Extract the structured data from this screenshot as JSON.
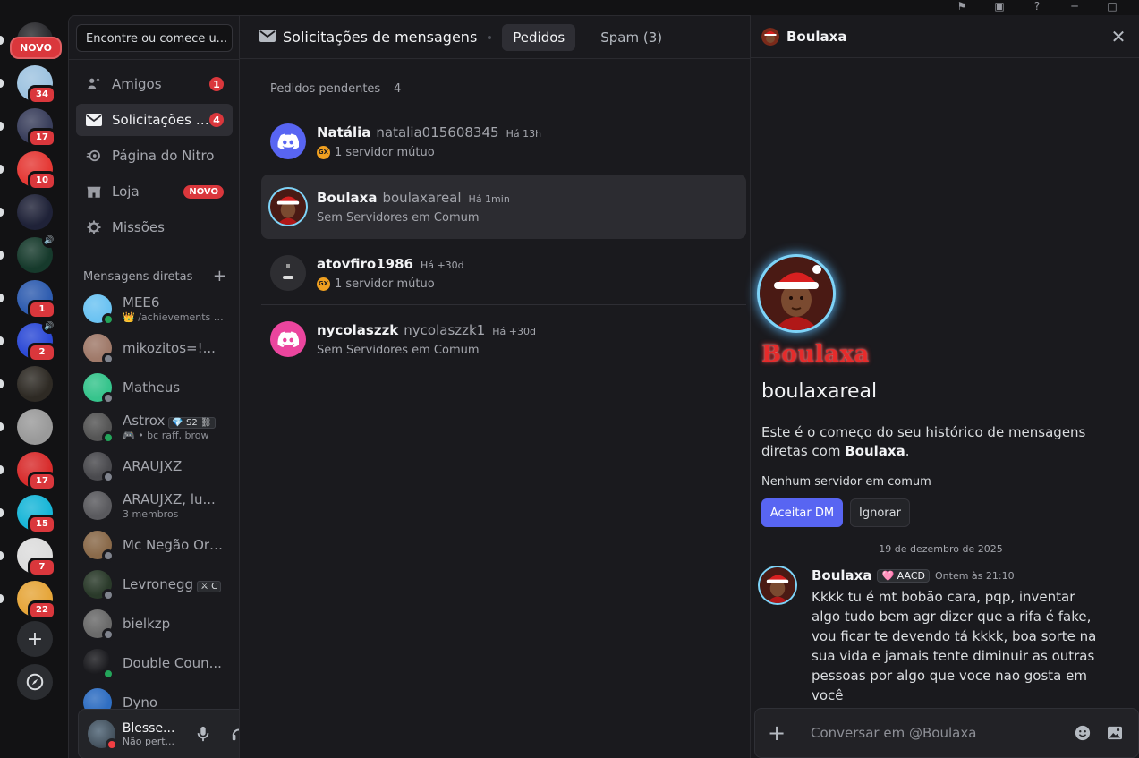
{
  "titlebar": {
    "icons": [
      "flag-icon",
      "inbox-icon",
      "help-icon",
      "minimize-icon",
      "maximize-icon"
    ]
  },
  "servers": {
    "new_badge": "NOVO",
    "items": [
      {
        "name": "server-1",
        "badge": "",
        "color": "#2a2a2e"
      },
      {
        "name": "server-gamers",
        "badge": "34",
        "color": "#9ec3e0"
      },
      {
        "name": "server-3",
        "badge": "17",
        "color": "#3a3f5c"
      },
      {
        "name": "server-4",
        "badge": "10",
        "color": "#e53935"
      },
      {
        "name": "server-5",
        "badge": "",
        "color": "#1f2238"
      },
      {
        "name": "server-6",
        "badge": "",
        "color": "#163a2c"
      },
      {
        "name": "server-7",
        "badge": "1",
        "color": "#2f5db0"
      },
      {
        "name": "server-8",
        "badge": "2",
        "color": "#2c4ad6"
      },
      {
        "name": "server-thats-cheapass",
        "badge": "",
        "color": "#2e2a24"
      },
      {
        "name": "server-10",
        "badge": "",
        "color": "#9a9a9a"
      },
      {
        "name": "server-11",
        "badge": "17",
        "color": "#d82c2c"
      },
      {
        "name": "server-12",
        "badge": "15",
        "color": "#18b6d8"
      },
      {
        "name": "server-13",
        "badge": "7",
        "color": "#dcdcdc"
      },
      {
        "name": "server-14",
        "badge": "22",
        "color": "#e6a63a"
      }
    ]
  },
  "sidebar": {
    "search_placeholder": "Encontre ou comece u...",
    "nav": [
      {
        "label": "Amigos",
        "count": "1"
      },
      {
        "label": "Solicitações de mensagens",
        "count": "4"
      },
      {
        "label": "Página do Nitro"
      },
      {
        "label": "Loja",
        "new": "NOVO"
      },
      {
        "label": "Missões"
      }
    ],
    "dm_header": "Mensagens diretas",
    "dms": [
      {
        "name": "MEE6",
        "sub": "👑 /achievements 👑",
        "status": "on",
        "color": "#6cc3f2"
      },
      {
        "name": "mikozitos=!...",
        "sub": "",
        "status": "off",
        "color": "#a07a6a"
      },
      {
        "name": "Matheus",
        "sub": "",
        "status": "off",
        "color": "#36c48c"
      },
      {
        "name": "Astrox",
        "tag": "💎 S2 ⛓",
        "sub": "🎮 • bc raff, brow",
        "status": "on",
        "color": "#555"
      },
      {
        "name": "ARAUJXZ",
        "sub": "",
        "status": "off",
        "color": "#4a4a4e"
      },
      {
        "name": "ARAUJXZ, lu...",
        "sub": "3 membros",
        "status": "",
        "color": "#5a5a5e"
      },
      {
        "name": "Mc Negão Ori...",
        "sub": "",
        "status": "off",
        "color": "#8a6a4a"
      },
      {
        "name": "Levronegg",
        "tag": "⚔ C",
        "sub": "",
        "status": "off",
        "color": "#2a3a2a"
      },
      {
        "name": "bielkzp",
        "sub": "",
        "status": "off",
        "color": "#6a6a6a"
      },
      {
        "name": "Double Coun...",
        "sub": "",
        "status": "on",
        "color": "#1a1a1e"
      },
      {
        "name": "Dyno",
        "sub": "",
        "status": "",
        "color": "#2f6ec2"
      }
    ],
    "user": {
      "name": "Blesse...",
      "status": "Não pert..."
    }
  },
  "main": {
    "title": "Solicitações de mensagens",
    "tabs": [
      {
        "label": "Pedidos"
      },
      {
        "label": "Spam (3)"
      }
    ],
    "pending_label": "Pedidos pendentes – 4",
    "requests": [
      {
        "name": "Natália",
        "username": "natalia015608345",
        "time": "Há 13h",
        "mutual": "1 servidor mútuo",
        "avatar_color": "#5865f2"
      },
      {
        "name": "Boulaxa",
        "username": "boulaxareal",
        "time": "Há 1min",
        "mutual": "Sem Servidores em Comum",
        "avatar_color": "#6b3a2a"
      },
      {
        "name": "atovfiro1986",
        "username": "",
        "time": "Há +30d",
        "mutual": "1 servidor mútuo",
        "avatar_color": "#2e2e32"
      },
      {
        "name": "nycolaszzk",
        "username": "nycolaszzk1",
        "time": "Há +30d",
        "mutual": "Sem Servidores em Comum",
        "avatar_color": "#eb459e"
      }
    ]
  },
  "panel": {
    "header_name": "Boulaxa",
    "display_name": "Boulaxa",
    "username": "boulaxareal",
    "history_prefix": "Este é o começo do seu histórico de mensagens diretas com ",
    "history_name": "Boulaxa",
    "history_suffix": ".",
    "no_servers": "Nenhum servidor em comum",
    "accept_label": "Aceitar DM",
    "ignore_label": "Ignorar",
    "date": "19 de dezembro de 2025",
    "message": {
      "author": "Boulaxa",
      "tag": "🩷 AACD",
      "time": "Ontem às 21:10",
      "text": "Kkkk tu é mt bobão cara, pqp, inventar algo tudo bem agr dizer que a rifa é fake, vou ficar te devendo tá kkkk, boa sorte na sua vida e jamais tente diminuir as outras pessoas por algo que voce nao gosta em você"
    },
    "composer_placeholder": "Conversar em @Boulaxa"
  },
  "colors": {
    "accent": "#5865f2",
    "danger": "#da373c",
    "online": "#23a55a"
  }
}
